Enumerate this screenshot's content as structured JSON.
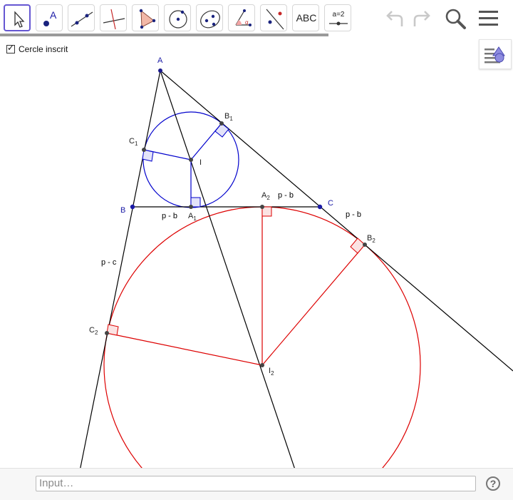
{
  "toolbar": {
    "tools": [
      {
        "name": "move-tool",
        "label": ""
      },
      {
        "name": "point-tool",
        "label": ""
      },
      {
        "name": "line-tool",
        "label": ""
      },
      {
        "name": "perpendicular-line-tool",
        "label": ""
      },
      {
        "name": "polygon-tool",
        "label": ""
      },
      {
        "name": "circle-center-point-tool",
        "label": ""
      },
      {
        "name": "conic-tool",
        "label": ""
      },
      {
        "name": "angle-tool",
        "label": ""
      },
      {
        "name": "reflect-tool",
        "label": ""
      },
      {
        "name": "text-tool",
        "label": "ABC"
      },
      {
        "name": "slider-tool",
        "label": "a=2"
      }
    ],
    "progress_fraction": 0.64
  },
  "checkbox": {
    "label": "Cercle inscrit",
    "checked": true
  },
  "labels": {
    "A": "A",
    "B": "B",
    "C": "C",
    "B1": "B",
    "B1_sub": "1",
    "C1": "C",
    "C1_sub": "1",
    "I": "I",
    "A1": "A",
    "A1_sub": "1",
    "A2": "A",
    "A2_sub": "2",
    "B2": "B",
    "B2_sub": "2",
    "C2": "C",
    "C2_sub": "2",
    "I2": "I",
    "I2_sub": "2",
    "pb1": "p - b",
    "pb2": "p - b",
    "pb3": "p - b",
    "pc": "p - c"
  },
  "input": {
    "placeholder": "Input…"
  },
  "help": {
    "label": "?"
  },
  "colors": {
    "accent": "#6557d2",
    "incircle": "#0000cc",
    "excircle": "#dd0000",
    "lines": "#000000"
  }
}
